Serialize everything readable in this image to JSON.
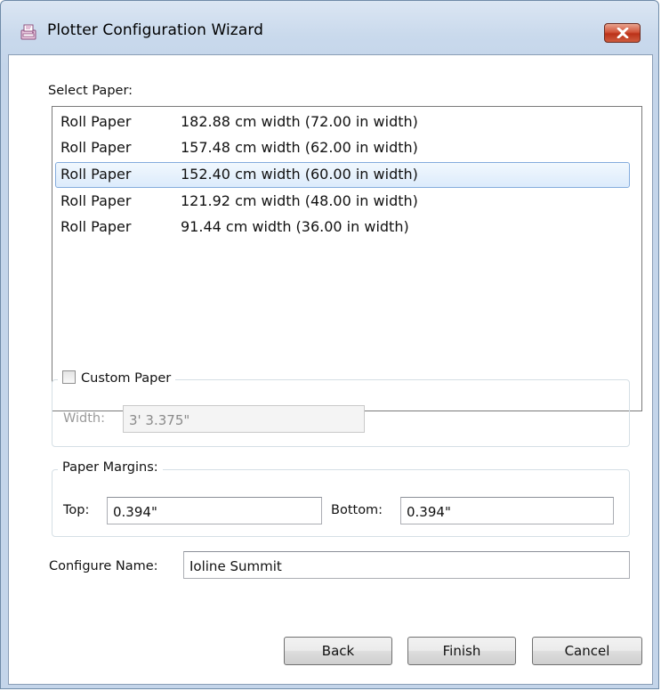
{
  "window": {
    "title": "Plotter Configuration Wizard"
  },
  "select_paper": {
    "label": "Select Paper:",
    "items": [
      {
        "type": "Roll Paper",
        "size": "182.88 cm width (72.00 in width)",
        "selected": false
      },
      {
        "type": "Roll Paper",
        "size": "157.48 cm width (62.00 in width)",
        "selected": false
      },
      {
        "type": "Roll Paper",
        "size": "152.40 cm width (60.00 in width)",
        "selected": true
      },
      {
        "type": "Roll Paper",
        "size": "121.92 cm width (48.00 in width)",
        "selected": false
      },
      {
        "type": "Roll Paper",
        "size": "91.44 cm width (36.00 in width)",
        "selected": false
      }
    ]
  },
  "custom_paper": {
    "checkbox_label": "Custom Paper",
    "checked": false,
    "width_label": "Width:",
    "width_value": "3' 3.375\""
  },
  "paper_margins": {
    "group_label": "Paper Margins:",
    "top_label": "Top:",
    "top_value": "0.394\"",
    "bottom_label": "Bottom:",
    "bottom_value": "0.394\""
  },
  "configure_name": {
    "label": "Configure Name:",
    "value": "Ioline Summit"
  },
  "buttons": {
    "back": "Back",
    "finish": "Finish",
    "cancel": "Cancel"
  },
  "icons": {
    "app": "plotter-app-icon",
    "close": "close-icon"
  },
  "colors": {
    "titlebar": "#c9d9ec",
    "close_button": "#c9452c",
    "selection_border": "#84acdd",
    "selection_fill": "#dcebfc"
  }
}
